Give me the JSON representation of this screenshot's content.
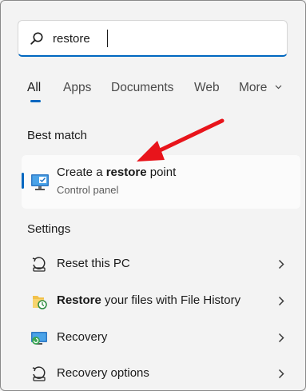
{
  "search": {
    "value": "restore"
  },
  "tabs": [
    {
      "label": "All",
      "active": true
    },
    {
      "label": "Apps"
    },
    {
      "label": "Documents"
    },
    {
      "label": "Web"
    },
    {
      "label": "More"
    }
  ],
  "best_match": {
    "heading": "Best match",
    "title_prefix": "Create a ",
    "title_bold": "restore",
    "title_suffix": " point",
    "subtitle": "Control panel",
    "icon": "monitor-checklist-icon"
  },
  "settings": {
    "heading": "Settings",
    "items": [
      {
        "prefix": "",
        "bold": "",
        "label": "Reset this PC",
        "icon": "reset-pc-icon"
      },
      {
        "prefix": "",
        "bold": "Restore",
        "label": " your files with File History",
        "icon": "file-history-icon"
      },
      {
        "prefix": "",
        "bold": "",
        "label": "Recovery",
        "icon": "recovery-icon"
      },
      {
        "prefix": "",
        "bold": "",
        "label": "Recovery options",
        "icon": "recovery-options-icon"
      }
    ]
  },
  "colors": {
    "accent": "#0067c0",
    "annotation_arrow": "#e8141b"
  }
}
